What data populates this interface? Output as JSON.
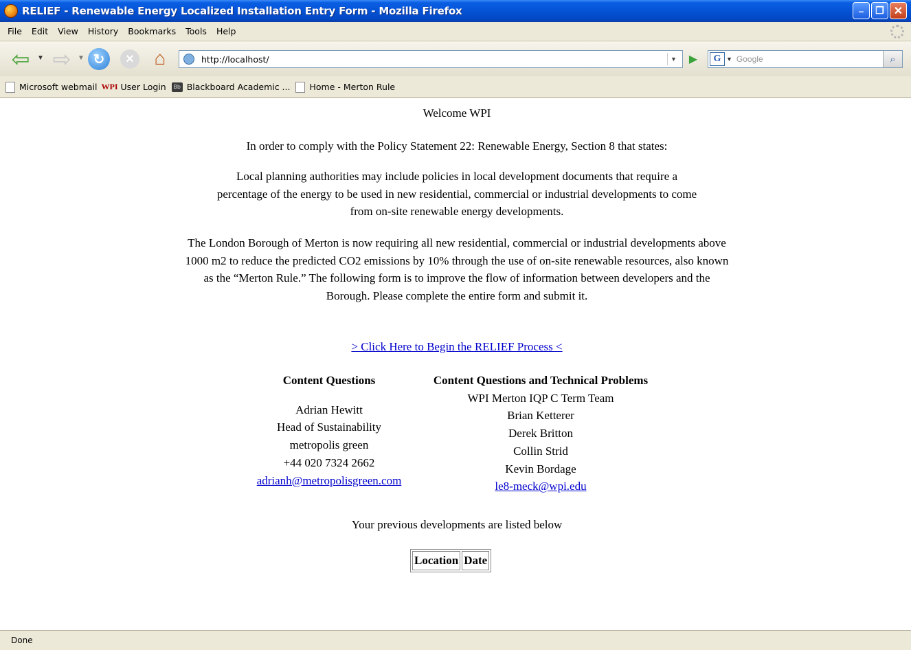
{
  "window": {
    "title": "RELIEF - Renewable Energy Localized Installation Entry Form - Mozilla Firefox",
    "controls": {
      "minimize": "–",
      "maximize": "❐",
      "close": "✕"
    }
  },
  "menu": [
    "File",
    "Edit",
    "View",
    "History",
    "Bookmarks",
    "Tools",
    "Help"
  ],
  "nav": {
    "url": "http://localhost/",
    "search_placeholder": "Google",
    "engine_letter": "G"
  },
  "bookmarks": [
    {
      "label": "Microsoft webmail",
      "icon": "page-icon"
    },
    {
      "label": "User Login",
      "icon": "wpi-logo-icon",
      "icon_text": "WPI"
    },
    {
      "label": "Blackboard Academic ...",
      "icon": "blackboard-icon",
      "icon_text": "Bb"
    },
    {
      "label": "Home - Merton Rule",
      "icon": "page-icon"
    }
  ],
  "page": {
    "welcome": "Welcome WPI",
    "intro": "In order to comply with the Policy Statement 22: Renewable Energy, Section 8 that states:",
    "quote": "Local planning authorities may include policies in local development documents that require a percentage of the energy to be used in new residential, commercial or industrial developments to come from on-site renewable energy developments.",
    "merton": "The London Borough of Merton is now requiring all new residential, commercial or industrial developments above 1000 m2 to reduce the predicted CO2 emissions by 10% through the use of on-site renewable resources, also known as the “Merton Rule.” The following form is to improve the flow of information between developers and the Borough. Please complete the entire form and submit it.",
    "begin_link": "> Click Here to Begin the RELIEF Process <",
    "contact1": {
      "heading": "Content Questions",
      "lines": [
        "Adrian Hewitt",
        "Head of Sustainability",
        "metropolis green",
        "+44 020 7324 2662"
      ],
      "email": "adrianh@metropolisgreen.com"
    },
    "contact2": {
      "heading": "Content Questions and Technical Problems",
      "lines": [
        "WPI Merton IQP C Term Team",
        "Brian Ketterer",
        "Derek Britton",
        "Collin Strid",
        "Kevin Bordage"
      ],
      "email": "le8-meck@wpi.edu"
    },
    "previous": "Your previous developments are listed below",
    "table_headers": [
      "Location",
      "Date"
    ]
  },
  "status": "Done"
}
